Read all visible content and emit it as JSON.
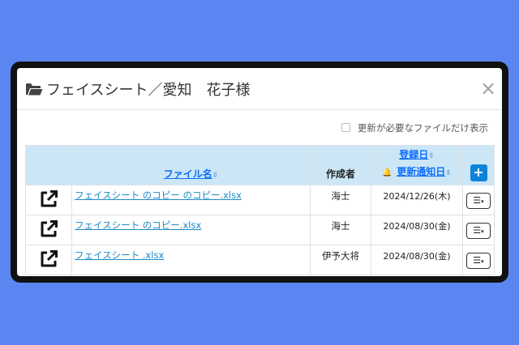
{
  "modal": {
    "title": "フェイスシート／愛知　花子様",
    "close_symbol": "×",
    "folder_icon": "folder-open-icon"
  },
  "filter": {
    "label": "更新が必要なファイルだけ表示",
    "checked": false
  },
  "table": {
    "headers": {
      "file_name": "ファイル名",
      "author": "作成者",
      "registered_date": "登録日",
      "update_notify_date": "更新通知日",
      "add_symbol": "+",
      "sort_symbol": "⇳"
    },
    "rows": [
      {
        "file_name": "フェイスシート のコピー のコピー.xlsx",
        "author": "海士",
        "date": "2024/12/26(木)"
      },
      {
        "file_name": "フェイスシート のコピー.xlsx",
        "author": "海士",
        "date": "2024/08/30(金)"
      },
      {
        "file_name": "フェイスシート .xlsx",
        "author": "伊予大将",
        "date": "2024/08/30(金)"
      }
    ],
    "menu_symbol": "☰",
    "caret_symbol": "▾"
  },
  "colors": {
    "background": "#5b86f2",
    "header_bg": "#cce6f5",
    "link": "#0d6efd",
    "add_button": "#0d84d9"
  }
}
